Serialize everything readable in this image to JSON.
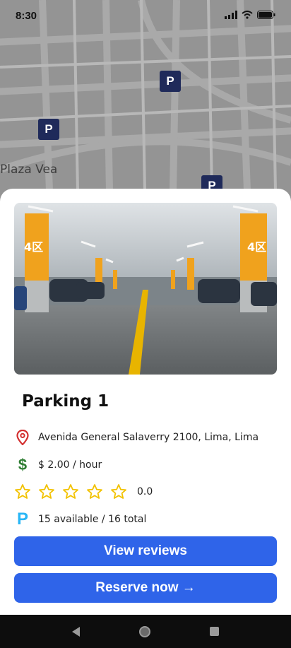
{
  "status_bar": {
    "time": "8:30"
  },
  "map": {
    "place_label": "Plaza Vea",
    "marker_label": "P"
  },
  "parking": {
    "title": "Parking 1",
    "address": "Avenida General Salaverry 2100, Lima, Lima",
    "price": "$ 2.00 / hour",
    "rating": "0.0",
    "rating_stars_filled": 0,
    "rating_stars_total": 5,
    "availability": "15 available / 16 total",
    "photo_pillar_label": "4区"
  },
  "actions": {
    "view_reviews": "View reviews",
    "reserve_now": "Reserve now →"
  },
  "colors": {
    "accent_button": "#2f64e9",
    "location_icon": "#d32f2f",
    "price_icon": "#2e7d32",
    "star_outline": "#f2c200",
    "parking_icon": "#29b6f6",
    "map_marker": "#1f2a5a"
  },
  "icons": [
    "location-pin-icon",
    "dollar-icon",
    "star-icon",
    "parking-icon",
    "signal-icon",
    "wifi-icon",
    "battery-icon",
    "back-icon",
    "home-icon",
    "recents-icon"
  ]
}
